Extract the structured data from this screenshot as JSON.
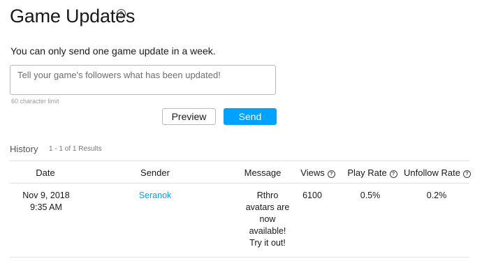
{
  "header": {
    "title": "Game Updates",
    "help_icon": "question-circle-icon"
  },
  "subtitle": "You can only send one game update in a week.",
  "update_input": {
    "value": "",
    "placeholder": "Tell your game's followers what has been updated!"
  },
  "character_limit": "60 character limit",
  "buttons": {
    "preview": "Preview",
    "send": "Send"
  },
  "history": {
    "label": "History",
    "results": "1 - 1 of 1 Results",
    "columns": {
      "date": "Date",
      "sender": "Sender",
      "message": "Message",
      "views": "Views",
      "play_rate": "Play Rate",
      "unfollow_rate": "Unfollow Rate"
    },
    "rows": [
      {
        "date": "Nov 9, 2018",
        "time": "9:35 AM",
        "sender": "Seranok",
        "message": "Rthro avatars are now available! Try it out!",
        "views": "6100",
        "play_rate": "0.5%",
        "unfollow_rate": "0.2%"
      }
    ]
  },
  "colors": {
    "accent": "#00a2ff",
    "text": "#191919",
    "border": "#b8b8b8",
    "divider": "#e3e3e3"
  }
}
